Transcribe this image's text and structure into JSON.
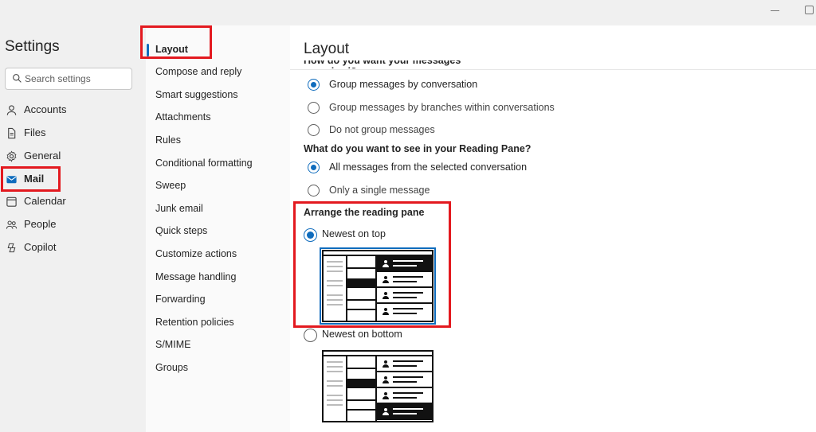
{
  "window": {
    "minimize_glyph": "",
    "maximize_glyph": ""
  },
  "left_nav": {
    "title": "Settings",
    "search_placeholder": "Search settings",
    "items": [
      {
        "label": "Accounts",
        "icon": "person-icon"
      },
      {
        "label": "Files",
        "icon": "file-icon"
      },
      {
        "label": "General",
        "icon": "gear-icon"
      },
      {
        "label": "Mail",
        "icon": "mail-icon",
        "selected": true
      },
      {
        "label": "Calendar",
        "icon": "calendar-icon"
      },
      {
        "label": "People",
        "icon": "people-icon"
      },
      {
        "label": "Copilot",
        "icon": "copilot-icon"
      }
    ]
  },
  "mid_nav": {
    "items": [
      {
        "label": "Layout",
        "selected": true
      },
      {
        "label": "Compose and reply"
      },
      {
        "label": "Smart suggestions"
      },
      {
        "label": "Attachments"
      },
      {
        "label": "Rules"
      },
      {
        "label": "Conditional formatting"
      },
      {
        "label": "Sweep"
      },
      {
        "label": "Junk email"
      },
      {
        "label": "Quick steps"
      },
      {
        "label": "Customize actions"
      },
      {
        "label": "Message handling"
      },
      {
        "label": "Forwarding"
      },
      {
        "label": "Retention policies"
      },
      {
        "label": "S/MIME"
      },
      {
        "label": "Groups"
      }
    ]
  },
  "content": {
    "title": "Layout",
    "cut_heading": "How do you want your messages organized?",
    "organize_options": [
      {
        "label": "Group messages by conversation",
        "checked": true
      },
      {
        "label": "Group messages by branches within conversations",
        "checked": false
      },
      {
        "label": "Do not group messages",
        "checked": false
      }
    ],
    "reading_pane_heading": "What do you want to see in your Reading Pane?",
    "reading_pane_options": [
      {
        "label": "All messages from the selected conversation",
        "checked": true
      },
      {
        "label": "Only a single message",
        "checked": false
      }
    ],
    "arrange_heading": "Arrange the reading pane",
    "arrange_options": [
      {
        "label": "Newest on top",
        "checked": true
      },
      {
        "label": "Newest on bottom",
        "checked": false
      }
    ]
  },
  "colors": {
    "accent": "#0f6cbd",
    "highlight": "#e3191f"
  }
}
